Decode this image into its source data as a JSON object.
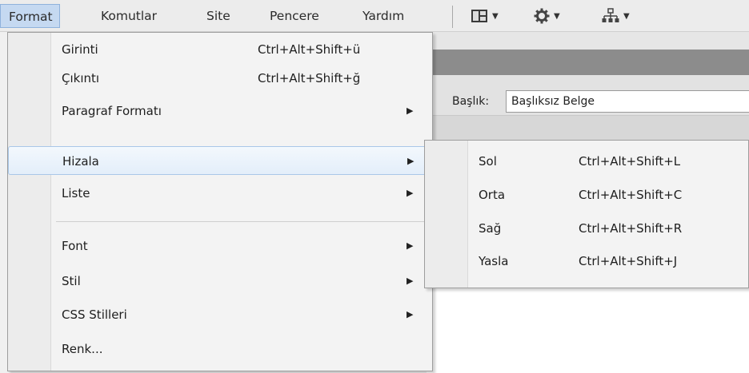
{
  "menubar": {
    "items": [
      "Format",
      "Komutlar",
      "Site",
      "Pencere",
      "Yardım"
    ],
    "tools": [
      {
        "icon": "layout-icon"
      },
      {
        "icon": "gear-icon"
      },
      {
        "icon": "site-map-icon"
      }
    ]
  },
  "panel": {
    "title_label": "Başlık:",
    "title_value": "Başlıksız Belge"
  },
  "format_menu": {
    "items": [
      {
        "label": "Girinti",
        "shortcut": "Ctrl+Alt+Shift+ü"
      },
      {
        "label": "Çıkıntı",
        "shortcut": "Ctrl+Alt+Shift+ğ"
      },
      {
        "label": "Paragraf Formatı",
        "submenu": true
      },
      {
        "label": "Hizala",
        "submenu": true,
        "highlighted": true
      },
      {
        "label": "Liste",
        "submenu": true
      },
      {
        "label": "Font",
        "submenu": true
      },
      {
        "label": "Stil",
        "submenu": true
      },
      {
        "label": "CSS Stilleri",
        "submenu": true
      },
      {
        "label": "Renk..."
      }
    ],
    "arrow_glyph": "▶"
  },
  "align_submenu": {
    "items": [
      {
        "label": "Sol",
        "shortcut": "Ctrl+Alt+Shift+L"
      },
      {
        "label": "Orta",
        "shortcut": "Ctrl+Alt+Shift+C"
      },
      {
        "label": "Sağ",
        "shortcut": "Ctrl+Alt+Shift+R"
      },
      {
        "label": "Yasla",
        "shortcut": "Ctrl+Alt+Shift+J"
      }
    ]
  },
  "colors": {
    "menubar_active": "#c5d9f1",
    "highlight_border": "#a9c7e8",
    "panel_strip": "#8c8c8c"
  }
}
